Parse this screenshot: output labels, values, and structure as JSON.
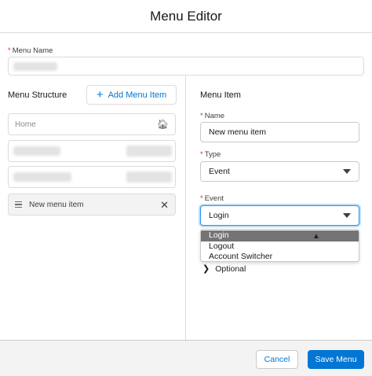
{
  "header": {
    "title": "Menu Editor"
  },
  "menu_name": {
    "required_marker": "*",
    "label": "Menu Name",
    "value": ""
  },
  "structure": {
    "title": "Menu Structure",
    "add_label": "Add Menu Item",
    "add_icon": "plus-icon",
    "items": [
      {
        "label": "Home",
        "icon": "home-icon"
      },
      {
        "label": ""
      },
      {
        "label": ""
      },
      {
        "label": "New menu item",
        "icon": "drag-handle-icon",
        "action_icon": "close-icon"
      }
    ]
  },
  "menu_item": {
    "title": "Menu Item",
    "required_marker": "*",
    "name_label": "Name",
    "name_value": "New menu item",
    "type_label": "Type",
    "type_value": "Event",
    "event_label": "Event",
    "event_value": "Login",
    "event_options": [
      "Login",
      "Logout",
      "Account Switcher"
    ],
    "optional_label": "Optional"
  },
  "footer": {
    "cancel_label": "Cancel",
    "save_label": "Save Menu"
  },
  "colors": {
    "brand": "#0176d3",
    "required": "#c23934",
    "highlight": "#747474",
    "border": "#dddbda"
  }
}
